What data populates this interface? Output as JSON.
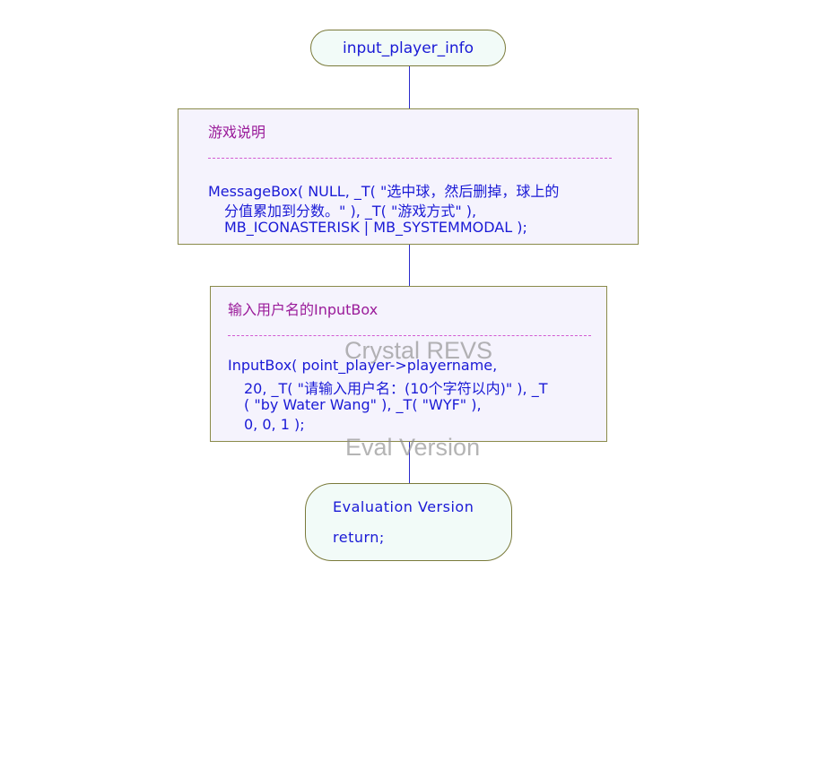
{
  "start_terminal": {
    "label": "input_player_info"
  },
  "process1": {
    "title": "游戏说明",
    "code": [
      "MessageBox( NULL, _T( \"选中球，然后删掉，球上的",
      "分值累加到分数。\" ), _T( \"游戏方式\" ),",
      "MB_ICONASTERISK | MB_SYSTEMMODAL );"
    ]
  },
  "process2": {
    "title": "输入用户名的InputBox",
    "code": [
      "InputBox( point_player->playername,",
      "20, _T( \"请输入用户名：(10个字符以内)\" ), _T",
      "( \"by Water Wang\" ), _T( \"WYF\" ),",
      "0, 0, 1 );"
    ]
  },
  "end_terminal": {
    "lines": [
      "Evaluation Version",
      "return;"
    ]
  },
  "watermark": {
    "line1": "Crystal REVS",
    "line2": "Eval Version"
  }
}
